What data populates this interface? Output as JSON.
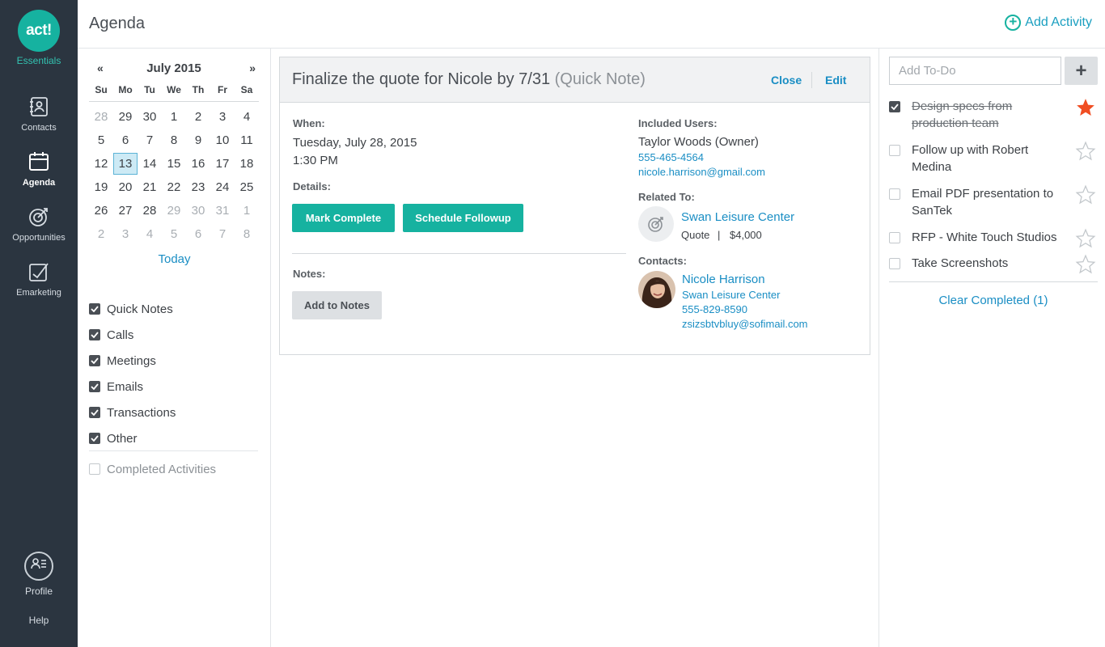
{
  "nav": {
    "logo_text": "act!",
    "logo_sub": "Essentials",
    "items": [
      {
        "label": "Contacts",
        "icon": "contacts-icon"
      },
      {
        "label": "Agenda",
        "icon": "calendar-icon"
      },
      {
        "label": "Opportunities",
        "icon": "target-icon"
      },
      {
        "label": "Emarketing",
        "icon": "emarketing-icon"
      }
    ],
    "profile": "Profile",
    "help": "Help"
  },
  "header": {
    "title": "Agenda",
    "add_activity": "Add Activity"
  },
  "calendar": {
    "prev": "«",
    "next": "»",
    "month": "July 2015",
    "weekdays": [
      "Su",
      "Mo",
      "Tu",
      "We",
      "Th",
      "Fr",
      "Sa"
    ],
    "weeks": [
      [
        "28",
        "29",
        "30",
        "1",
        "2",
        "3",
        "4"
      ],
      [
        "5",
        "6",
        "7",
        "8",
        "9",
        "10",
        "11"
      ],
      [
        "12",
        "13",
        "14",
        "15",
        "16",
        "17",
        "18"
      ],
      [
        "19",
        "20",
        "21",
        "22",
        "23",
        "24",
        "25"
      ],
      [
        "26",
        "27",
        "28",
        "29",
        "30",
        "31",
        "1"
      ],
      [
        "2",
        "3",
        "4",
        "5",
        "6",
        "7",
        "8"
      ]
    ],
    "selected": "13",
    "today": "Today"
  },
  "filters": {
    "items": [
      {
        "label": "Quick Notes",
        "checked": true
      },
      {
        "label": "Calls",
        "checked": true
      },
      {
        "label": "Meetings",
        "checked": true
      },
      {
        "label": "Emails",
        "checked": true
      },
      {
        "label": "Transactions",
        "checked": true
      },
      {
        "label": "Other",
        "checked": true
      }
    ],
    "completed": {
      "label": "Completed Activities",
      "checked": false
    }
  },
  "detail": {
    "title": "Finalize the quote for Nicole by 7/31",
    "type": "(Quick Note)",
    "close": "Close",
    "edit": "Edit",
    "when_label": "When:",
    "date": "Tuesday, July 28, 2015",
    "time": "1:30 PM",
    "details_label": "Details:",
    "mark_complete": "Mark Complete",
    "schedule_followup": "Schedule Followup",
    "notes_label": "Notes:",
    "add_to_notes": "Add to Notes",
    "included_label": "Included Users:",
    "user_name": "Taylor Woods (Owner)",
    "user_phone": "555-465-4564",
    "user_email": "nicole.harrison@gmail.com",
    "related_label": "Related To:",
    "related_name": "Swan Leisure Center",
    "related_kind": "Quote",
    "related_sep": "|",
    "related_amount": "$4,000",
    "contacts_label": "Contacts:",
    "contact_name": "Nicole Harrison",
    "contact_company": "Swan Leisure Center",
    "contact_phone": "555-829-8590",
    "contact_email": "zsizsbtvbluy@sofimail.com"
  },
  "todo": {
    "placeholder": "Add To-Do",
    "add": "+",
    "items": [
      {
        "text": "Design specs from production team",
        "done": true,
        "starred": true
      },
      {
        "text": "Follow up with Robert Medina",
        "done": false,
        "starred": false
      },
      {
        "text": "Email PDF presentation to SanTek",
        "done": false,
        "starred": false
      },
      {
        "text": "RFP - White Touch Studios",
        "done": false,
        "starred": false
      },
      {
        "text": "Take Screenshots",
        "done": false,
        "starred": false
      }
    ],
    "clear_completed": "Clear Completed (1)"
  },
  "colors": {
    "accent": "#16b2a0",
    "link": "#1a8ec4",
    "nav_bg": "#2b3540",
    "star_active": "#f04e23"
  }
}
